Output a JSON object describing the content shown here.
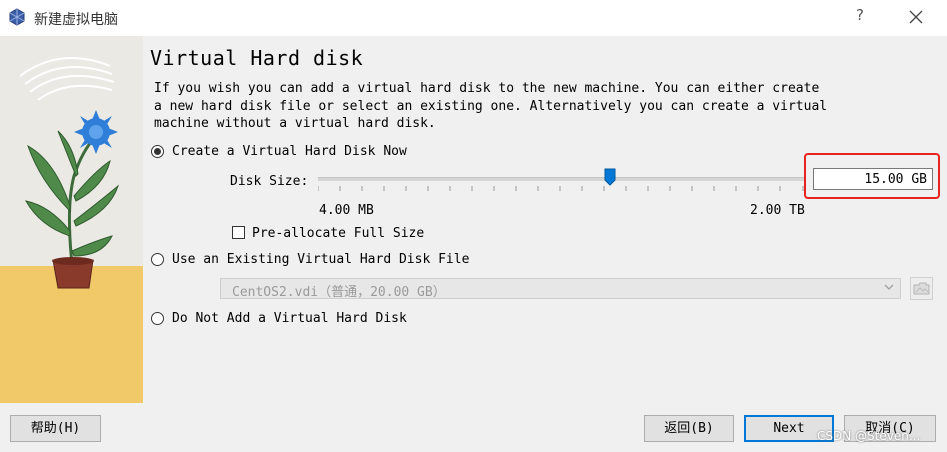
{
  "window": {
    "title": "新建虚拟电脑",
    "help_glyph": "?"
  },
  "page": {
    "heading": "Virtual Hard disk",
    "description": "If you wish you can add a virtual hard disk to the new machine. You can either create\na new hard disk file or select an existing one. Alternatively you can create a virtual\nmachine without a virtual hard disk."
  },
  "options": {
    "create_new": {
      "label": "Create a Virtual Hard Disk Now",
      "checked": true
    },
    "use_existing": {
      "label": "Use an Existing Virtual Hard Disk File",
      "checked": false
    },
    "do_not_add": {
      "label": "Do Not Add a Virtual Hard Disk",
      "checked": false
    }
  },
  "disk_size": {
    "label": "Disk Size:",
    "value": "15.00 GB",
    "min_label": "4.00 MB",
    "max_label": "2.00 TB",
    "slider_level_fraction": 0.6
  },
  "preallocate": {
    "label": "Pre-allocate Full Size",
    "checked": false
  },
  "existing_file": {
    "selected": "CentOS2.vdi（普通，20.00 GB）"
  },
  "footer": {
    "help": "帮助(H)",
    "back": "返回(B)",
    "next": "Next",
    "cancel": "取消(C)"
  },
  "watermark": "CSDN @Steven...",
  "icons": {
    "app": "virtualbox-icon",
    "close": "close-icon",
    "slider": "slider-handle-icon",
    "dropdown": "chevron-down-icon",
    "folder": "folder-icon",
    "illustration": "flower-pot-illustration"
  },
  "colors": {
    "accent": "#0078d7",
    "highlight": "#e8231d",
    "flower": "#2f7fd8",
    "floor": "#f2c969"
  }
}
